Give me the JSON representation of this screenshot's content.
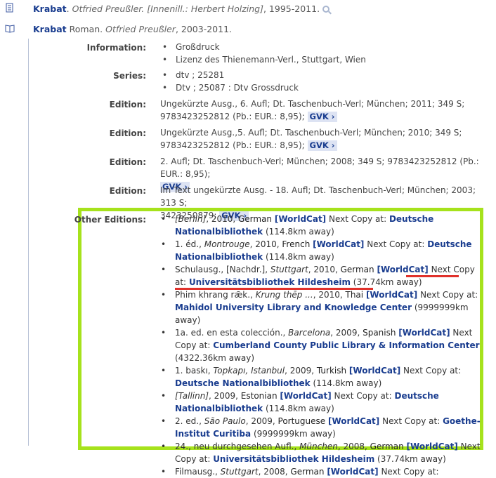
{
  "records": [
    {
      "title": "Krabat",
      "rest": ". ",
      "meta": "Otfried Preußler. [Innenill.: Herbert Holzing]",
      "years": ", 1995-2011."
    },
    {
      "title": "Krabat",
      "rest": " Roman. ",
      "meta": "Otfried Preußler",
      "years": ", 2003-2011."
    }
  ],
  "labels": {
    "information": "Information:",
    "series": "Series:",
    "edition": "Edition:",
    "other_editions": "Other Editions:"
  },
  "information": [
    "Großdruck",
    "Lizenz des Thienemann-Verl., Stuttgart, Wien"
  ],
  "series": [
    "dtv ; 25281",
    "Dtv ; 25087 : Dtv Grossdruck"
  ],
  "editions": [
    {
      "l1": "Ungekürzte Ausg., 6. Aufl; Dt. Taschenbuch-Verl; München; 2011; 349 S;",
      "l2": "9783423252812 (Pb.: EUR.: 8,95);"
    },
    {
      "l1": "Ungekürzte Ausg.,5. Aufl; Dt. Taschenbuch-Verl; München; 2010; 349 S;",
      "l2": "9783423252812 (Pb.: EUR.: 8,95);"
    },
    {
      "l1": "2. Aufl; Dt. Taschenbuch-Verl; München; 2008; 349 S; 9783423252812 (Pb.: EUR.: 8,95);",
      "l2": ""
    },
    {
      "l1": "Im Text ungekürzte Ausg. - 18. Aufl; Dt. Taschenbuch-Verl; München; 2003; 313 S;",
      "l2": "3423250879;"
    }
  ],
  "gvk_label": "GVK ›",
  "worldcat_label": "[WorldCat]",
  "next_copy": "Next Copy at:",
  "other_editions": [
    {
      "pre": "",
      "place": "[Berlin]",
      "year": ", 2010, ",
      "lang": "German",
      "lib": "Deutsche Nationalbibliothek",
      "dist": "(114.8km away)"
    },
    {
      "pre": "1. éd., ",
      "place": "Montrouge",
      "year": ", 2010, ",
      "lang": "French",
      "lib": "Deutsche Nationalbibliothek",
      "dist": "(114.8km away)"
    },
    {
      "pre": "Schulausg., [Nachdr.], ",
      "place": "Stuttgart",
      "year": ", 2010, ",
      "lang": "German",
      "lib": "Universitätsbibliothek Hildesheim",
      "dist": "(37.74km away)"
    },
    {
      "pre": "Phim khrang rǣk., ",
      "place": "Krung thēp ...",
      "year": ", 2010, ",
      "lang": "Thai",
      "lib": "Mahidol University Library and Knowledge Center",
      "dist": "(9999999km away)"
    },
    {
      "pre": "1a. ed. en esta colección., ",
      "place": "Barcelona",
      "year": ", 2009, ",
      "lang": "Spanish",
      "lib": "Cumberland County Public Library & Information Center",
      "dist": "(4322.36km away)"
    },
    {
      "pre": "1. baskı, ",
      "place": "Topkapı, Istanbul",
      "year": ", 2009, ",
      "lang": "Turkish",
      "lib": "Deutsche Nationalbibliothek",
      "dist": "(114.8km away)"
    },
    {
      "pre": "",
      "place": "[Tallinn]",
      "year": ", 2009, ",
      "lang": "Estonian",
      "lib": "Deutsche Nationalbibliothek",
      "dist": "(114.8km away)"
    },
    {
      "pre": "2. ed., ",
      "place": "São Paulo",
      "year": ", 2009, ",
      "lang": "Portuguese",
      "lib": "Goethe-Institut Curitiba",
      "dist": "(9999999km away)"
    },
    {
      "pre": "24., neu durchgesehen Aufl., ",
      "place": "München",
      "year": ", 2008, ",
      "lang": "German",
      "lib": "Universitätsbibliothek Hildesheim",
      "dist": "(37.74km away)"
    },
    {
      "pre": "Filmausg., ",
      "place": "Stuttgart",
      "year": ", 2008, ",
      "lang": "German",
      "lib": "",
      "dist": ""
    }
  ],
  "colors": {
    "accent": "#1a3d8f",
    "highlight_box": "#a6e21c",
    "underline": "#e0312b"
  }
}
